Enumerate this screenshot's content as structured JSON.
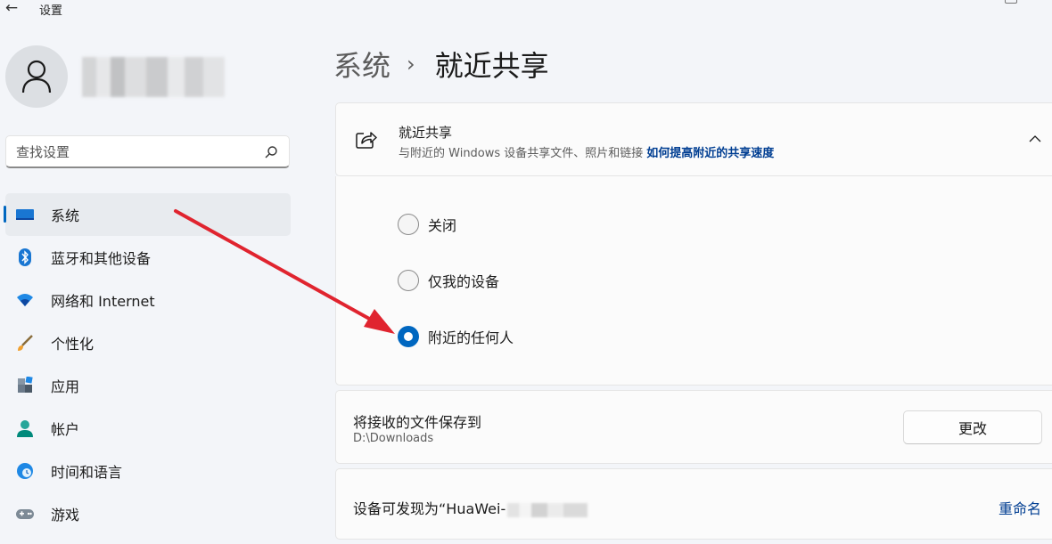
{
  "window": {
    "title": "设置"
  },
  "sidebar": {
    "search_placeholder": "查找设置",
    "items": [
      {
        "label": "系统",
        "icon": "monitor-icon",
        "active": true
      },
      {
        "label": "蓝牙和其他设备",
        "icon": "bluetooth-icon"
      },
      {
        "label": "网络和 Internet",
        "icon": "wifi-icon"
      },
      {
        "label": "个性化",
        "icon": "brush-icon"
      },
      {
        "label": "应用",
        "icon": "apps-icon"
      },
      {
        "label": "帐户",
        "icon": "account-icon"
      },
      {
        "label": "时间和语言",
        "icon": "globe-clock-icon"
      },
      {
        "label": "游戏",
        "icon": "gamepad-icon"
      }
    ]
  },
  "breadcrumb": {
    "parent": "系统",
    "separator": "›",
    "current": "就近共享"
  },
  "nearby_share": {
    "title": "就近共享",
    "description": "与附近的 Windows 设备共享文件、照片和链接",
    "link": "如何提高附近的共享速度",
    "options": [
      {
        "label": "关闭",
        "checked": false
      },
      {
        "label": "仅我的设备",
        "checked": false
      },
      {
        "label": "附近的任何人",
        "checked": true
      }
    ]
  },
  "save_location": {
    "title": "将接收的文件保存到",
    "path": "D:\\Downloads",
    "button": "更改"
  },
  "discoverable": {
    "label": "设备可发现为“HuaWei-",
    "rename": "重命名"
  },
  "colors": {
    "accent": "#0067c0",
    "link": "#003e92",
    "annotation_arrow": "#e0242f"
  }
}
